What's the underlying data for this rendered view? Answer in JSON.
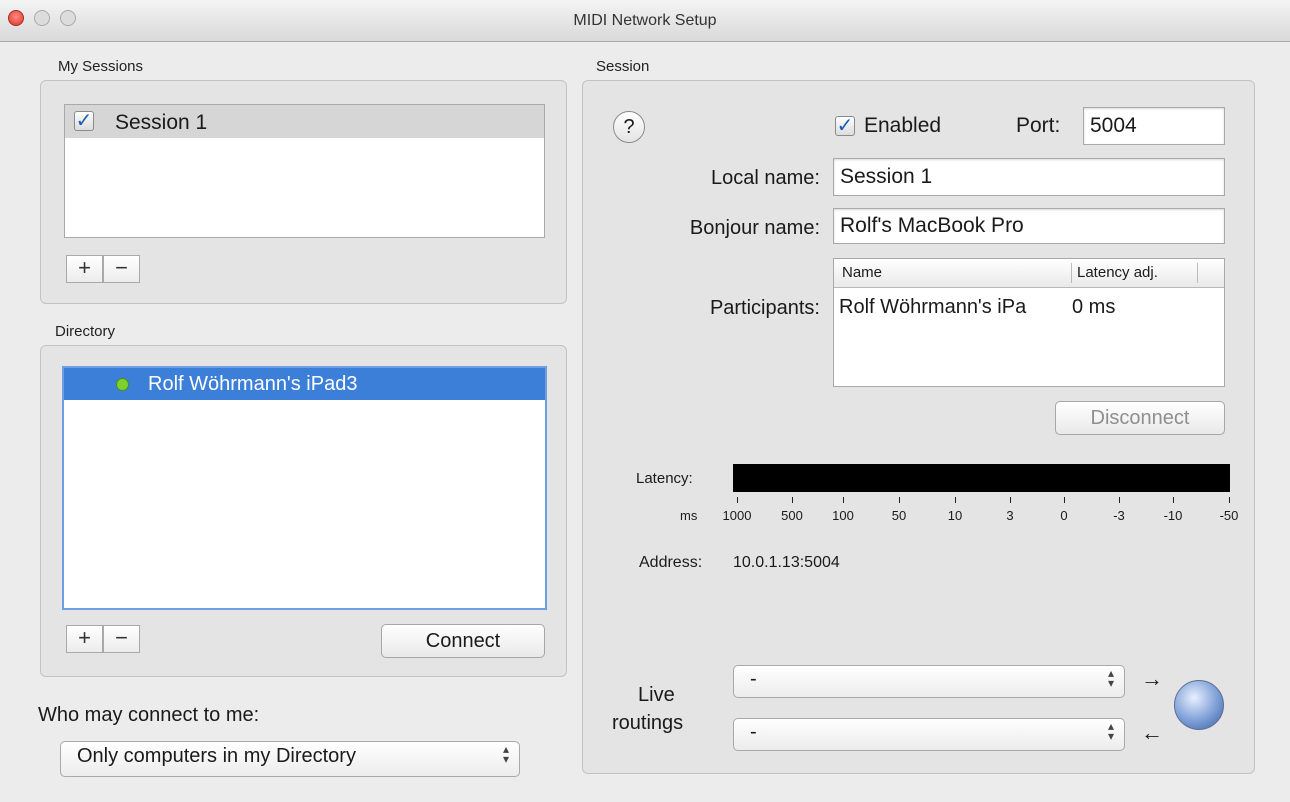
{
  "window": {
    "title": "MIDI Network Setup"
  },
  "my_sessions": {
    "label": "My Sessions",
    "items": [
      {
        "label": "Session 1",
        "checked": true
      }
    ],
    "add_label": "+",
    "remove_label": "−"
  },
  "directory": {
    "label": "Directory",
    "items": [
      {
        "label": "Rolf Wöhrmann's iPad3",
        "status_color": "#7bd12e",
        "selected": true
      }
    ],
    "add_label": "+",
    "remove_label": "−",
    "connect_label": "Connect"
  },
  "who_may_connect": {
    "label": "Who may connect to me:",
    "selected": "Only computers in my Directory"
  },
  "session": {
    "label": "Session",
    "help_label": "?",
    "enabled_label": "Enabled",
    "enabled_checked": true,
    "port_label": "Port:",
    "port_value": "5004",
    "local_name_label": "Local name:",
    "local_name_value": "Session 1",
    "bonjour_name_label": "Bonjour name:",
    "bonjour_name_value": "Rolf's MacBook Pro",
    "participants_label": "Participants:",
    "participants_columns": [
      "Name",
      "Latency adj."
    ],
    "participants_rows": [
      {
        "name": "Rolf Wöhrmann's iPa",
        "latency": "0 ms"
      }
    ],
    "disconnect_label": "Disconnect",
    "latency_label": "Latency:",
    "latency_unit": "ms",
    "latency_ticks": [
      "1000",
      "500",
      "100",
      "50",
      "10",
      "3",
      "0",
      "-3",
      "-10",
      "-50"
    ],
    "address_label": "Address:",
    "address_value": "10.0.1.13:5004",
    "live_routings_label_line1": "Live",
    "live_routings_label_line2": "routings",
    "routing_out_value": "-",
    "routing_in_value": "-",
    "routing_out_arrow": "→",
    "routing_in_arrow": "←"
  },
  "colors": {
    "selection": "#3b7fd9",
    "status_green": "#7bd12e",
    "latency_bar": "#000000"
  },
  "icons": {
    "routing_globe": "globe-icon",
    "popup_arrows": "updown-chevron-icon"
  }
}
